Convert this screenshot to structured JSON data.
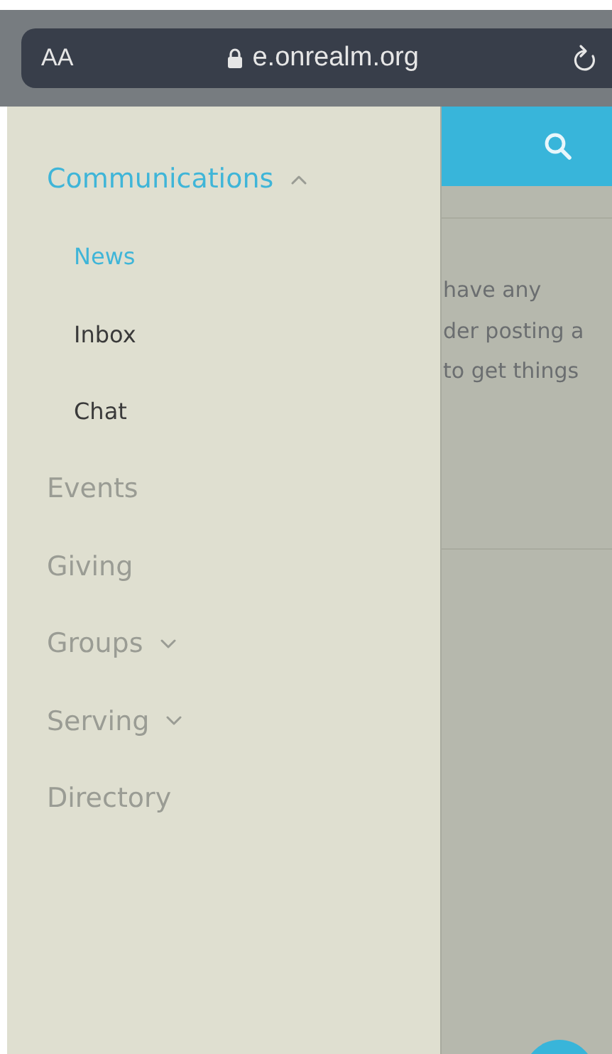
{
  "browser_bar": {
    "text_size_label": "AA",
    "url": "e.onrealm.org"
  },
  "menu": [
    {
      "label": "Communications",
      "expanded": true,
      "children": [
        {
          "label": "News",
          "selected": true
        },
        {
          "label": "Inbox",
          "selected": false
        },
        {
          "label": "Chat",
          "selected": false
        }
      ]
    },
    {
      "label": "Events"
    },
    {
      "label": "Giving"
    },
    {
      "label": "Groups",
      "expanded": false
    },
    {
      "label": "Serving",
      "expanded": false
    },
    {
      "label": "Directory"
    }
  ],
  "page_behind": {
    "text_lines": [
      "have any",
      "der posting a",
      "to get things"
    ]
  }
}
